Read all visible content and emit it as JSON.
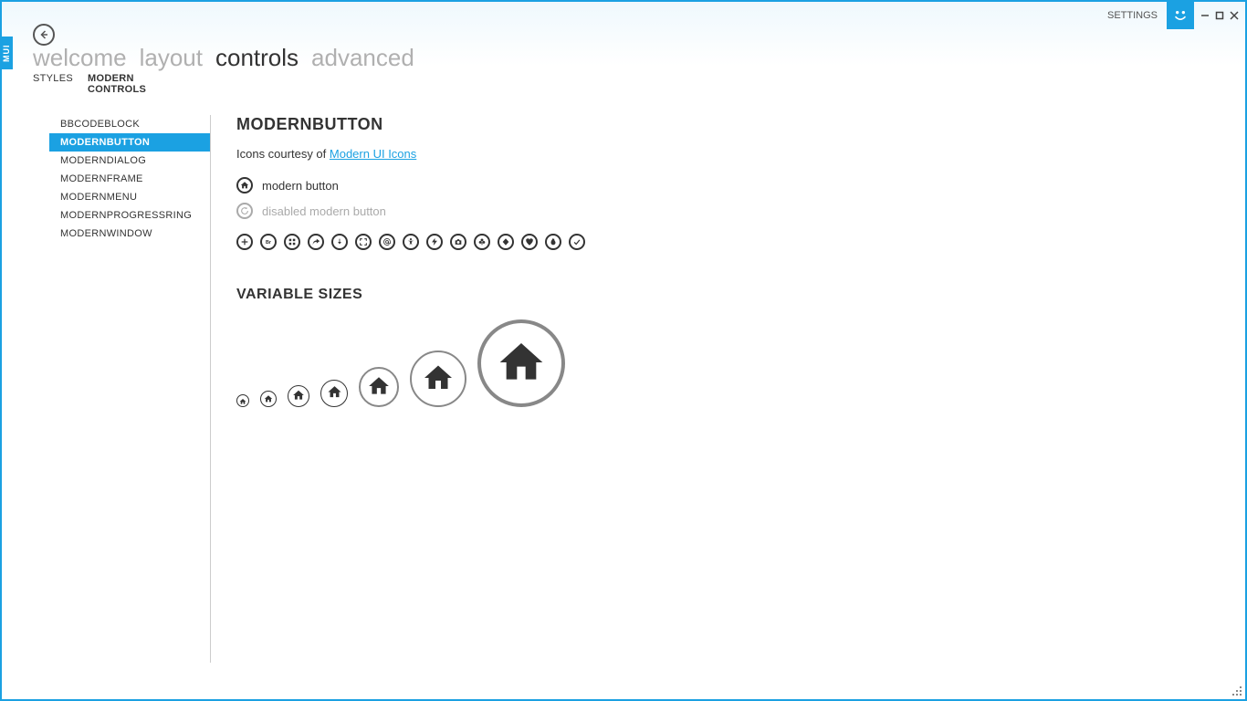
{
  "titlebar": {
    "settings": "SETTINGS",
    "mui_tab": "MUI"
  },
  "main_nav": {
    "items": [
      "welcome",
      "layout",
      "controls",
      "advanced"
    ],
    "active_index": 2
  },
  "sub_nav": {
    "items": [
      "STYLES",
      "MODERN CONTROLS"
    ],
    "active_index": 1
  },
  "sidenav": {
    "items": [
      "BBCODEBLOCK",
      "MODERNBUTTON",
      "MODERNDIALOG",
      "MODERNFRAME",
      "MODERNMENU",
      "MODERNPROGRESSRING",
      "MODERNWINDOW"
    ],
    "selected_index": 1
  },
  "content": {
    "title": "MODERNBUTTON",
    "intro_prefix": "Icons courtesy of ",
    "intro_link": "Modern UI Icons",
    "button_normal": "modern button",
    "button_disabled": "disabled modern button",
    "icon_grid": [
      "add-icon",
      "br-icon",
      "grid-icon",
      "share-icon",
      "download-icon",
      "fullscreen-icon",
      "at-icon",
      "accessibility-icon",
      "flash-icon",
      "camera-icon",
      "club-icon",
      "diamond-icon",
      "heart-icon",
      "flame-icon",
      "check-icon"
    ],
    "section2_title": "VARIABLE SIZES",
    "sizes": [
      14,
      18,
      24,
      30,
      44,
      62,
      96
    ]
  },
  "colors": {
    "accent": "#1ba1e2",
    "muted": "#aaaaaa",
    "text": "#333333"
  }
}
